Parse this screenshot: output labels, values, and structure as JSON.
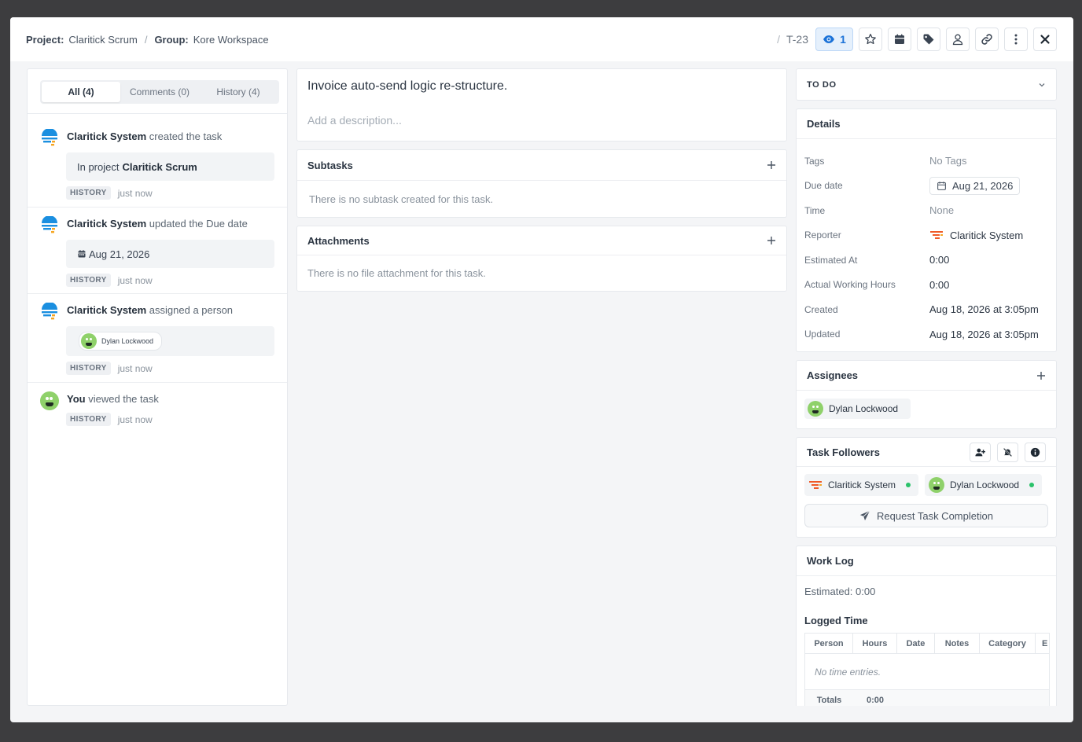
{
  "header": {
    "project_label": "Project:",
    "project_value": "Claritick Scrum",
    "separator": "/",
    "group_label": "Group:",
    "group_value": "Kore Workspace",
    "task_id": "T-23",
    "watchers_count": "1",
    "buttons": [
      "eye-icon",
      "star-icon",
      "calendar-icon",
      "tag-icon",
      "user-icon",
      "link-icon",
      "more-vertical-icon",
      "close-icon"
    ]
  },
  "activity": {
    "tabs": [
      {
        "label": "All (4)",
        "active": true
      },
      {
        "label": "Comments (0)",
        "active": false
      },
      {
        "label": "History (4)",
        "active": false
      }
    ],
    "items": [
      {
        "actor": "Claritick System",
        "action": "created the task",
        "box_prefix": "In project",
        "box_strong": "Claritick Scrum",
        "badge": "HISTORY",
        "time": "just now"
      },
      {
        "actor": "Claritick System",
        "action": "updated the Due date",
        "box_value": "Aug 21, 2026",
        "badge": "HISTORY",
        "time": "just now"
      },
      {
        "actor": "Claritick System",
        "action": "assigned a person",
        "box_person": "Dylan Lockwood",
        "badge": "HISTORY",
        "time": "just now"
      },
      {
        "actor": "You",
        "action": "viewed the task",
        "badge": "HISTORY",
        "time": "just now"
      }
    ]
  },
  "task": {
    "title": "Invoice auto-send logic re-structure.",
    "description_placeholder": "Add a description...",
    "subtasks_title": "Subtasks",
    "subtasks_empty": "There is no subtask created for this task.",
    "attachments_title": "Attachments",
    "attachments_empty": "There is no file attachment for this task."
  },
  "status": {
    "value": "TO DO"
  },
  "details": {
    "title": "Details",
    "rows": {
      "tags": {
        "label": "Tags",
        "value": "No Tags"
      },
      "due": {
        "label": "Due date",
        "value": "Aug 21, 2026"
      },
      "time": {
        "label": "Time",
        "value": "None"
      },
      "reporter": {
        "label": "Reporter",
        "value": "Claritick System"
      },
      "estimated": {
        "label": "Estimated At",
        "value": "0:00"
      },
      "actual": {
        "label": "Actual Working Hours",
        "value": "0:00"
      },
      "created": {
        "label": "Created",
        "value": "Aug 18, 2026 at 3:05pm"
      },
      "updated": {
        "label": "Updated",
        "value": "Aug 18, 2026 at 3:05pm"
      }
    }
  },
  "assignees": {
    "title": "Assignees",
    "items": [
      "Dylan Lockwood"
    ]
  },
  "followers": {
    "title": "Task Followers",
    "items": [
      "Claritick System",
      "Dylan Lockwood"
    ],
    "request_label": "Request Task Completion"
  },
  "worklog": {
    "title": "Work Log",
    "estimated": "Estimated: 0:00",
    "logged_title": "Logged Time",
    "columns": [
      "Person",
      "Hours",
      "Date",
      "Notes",
      "Category",
      "E"
    ],
    "empty": "No time entries.",
    "totals_label": "Totals",
    "totals_value": "0:00"
  },
  "colors": {
    "accent": "#1b72d8",
    "online": "#2bc26a",
    "system_orange": "#f05a28",
    "system_blue": "#1b8fe0"
  }
}
